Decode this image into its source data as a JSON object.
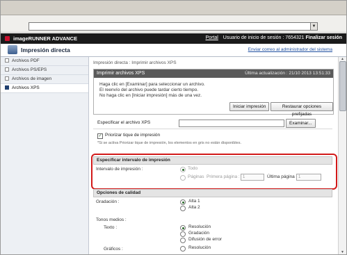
{
  "header": {
    "brand": "imageRUNNER ADVANCE",
    "portal_link": "Portal",
    "user_info": "Usuario de inicio de sesión : 7654321",
    "logout": "Finalizar sesión"
  },
  "app": {
    "title": "Impresión directa",
    "admin_link": "Enviar correo al administrador del sistema"
  },
  "sidebar": {
    "items": [
      {
        "label": "Archivos PDF"
      },
      {
        "label": "Archivos PS/EPS"
      },
      {
        "label": "Archivos de imagen"
      },
      {
        "label": "Archivos XPS"
      }
    ]
  },
  "main": {
    "breadcrumb": "Impresión directa : Imprimir archivos XPS",
    "panel": {
      "title": "Imprimir archivos XPS",
      "last_update": "Última actualización : 21/10 2013 13:51:33",
      "instructions": [
        "Haga clic en [Examinar] para seleccionar un archivo.",
        "El reenvío del archivo puede tardar cierto tiempo.",
        "No haga clic en [Iniciar impresión] más de una vez."
      ],
      "start_button": "Iniciar impresión",
      "restore_button": "Restaurar opciones prefijadas"
    },
    "file": {
      "label": "Especificar el archivo XPS",
      "value": "",
      "browse_button": "Examinar..."
    },
    "priority": {
      "label": "Priorizar tique de impresión",
      "checked": true,
      "note": "*Si se activa Priorizar tique de impresión, los elementos en gris no están disponibles."
    },
    "range": {
      "title": "Especificar intervalo de impresión",
      "label": "Intervalo de impresión :",
      "opt_all": "Todo",
      "opt_pages": "Páginas",
      "first_page_label": "Primera página :",
      "first_page_value": "1",
      "last_page_label": "Última página :",
      "last_page_value": "1"
    },
    "quality": {
      "title": "Opciones de calidad",
      "gradation_label": "Gradación :",
      "gradation_opts": [
        "Alta 1",
        "Alta 2"
      ],
      "halftones_label": "Tonos medios :",
      "text_label": "Texto :",
      "text_opts": [
        "Resolución",
        "Gradación",
        "Difusión de error"
      ],
      "graphics_label": "Gráficos :",
      "graphics_opts": [
        "Resolución"
      ]
    }
  }
}
